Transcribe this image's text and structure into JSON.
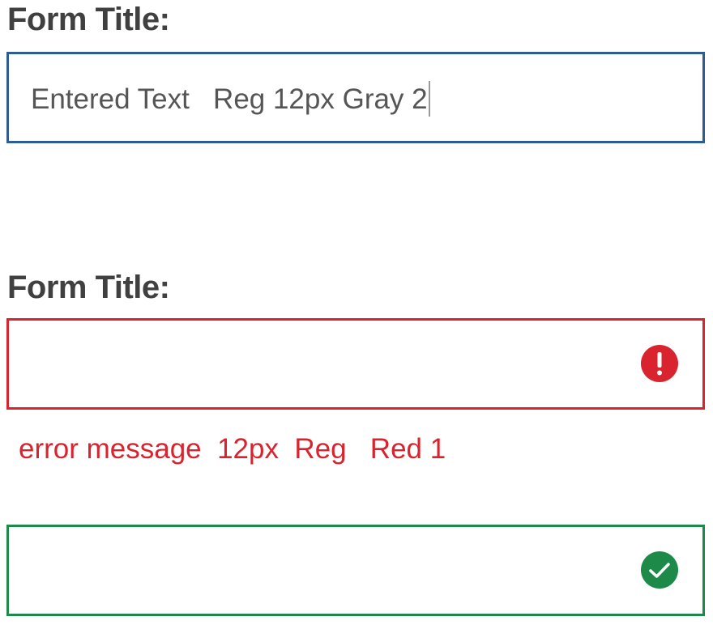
{
  "colors": {
    "active_border": "#2E5C92",
    "error_red": "#D9232E",
    "success_green": "#1E8A4A",
    "entered_text_gray": "#555555",
    "title_text": "#404040"
  },
  "form_default": {
    "title": "Form Title:",
    "value": "Entered Text   Reg 12px Gray 2"
  },
  "form_error": {
    "title": "Form Title:",
    "icon": "error-exclamation-icon",
    "error_message": "error message  12px  Reg   Red 1"
  },
  "form_success": {
    "icon": "success-check-icon"
  }
}
